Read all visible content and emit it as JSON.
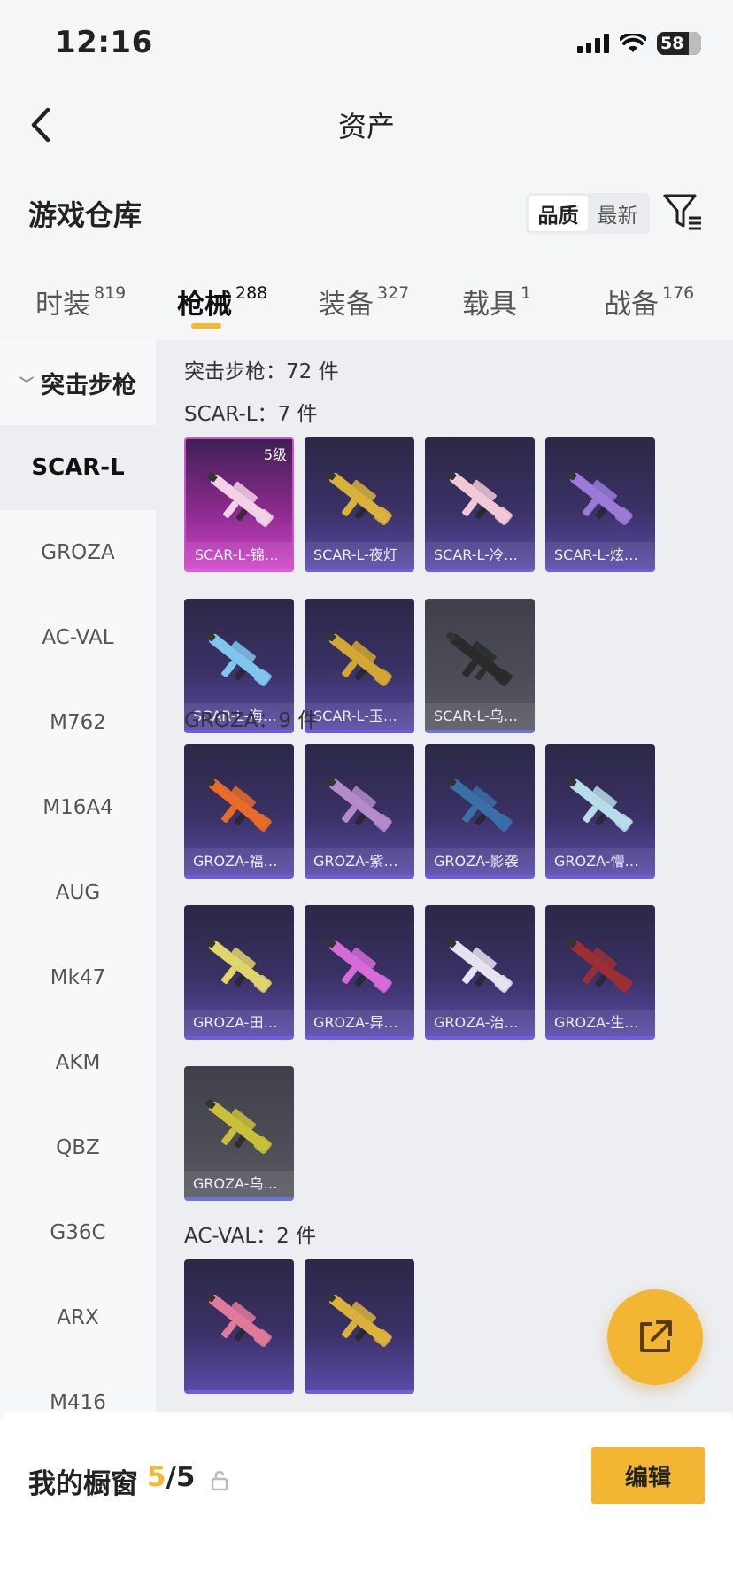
{
  "status": {
    "time": "12:16",
    "battery": "58"
  },
  "header": {
    "title": "资产"
  },
  "section": {
    "title": "游戏仓库",
    "sort_options": [
      "品质",
      "最新"
    ],
    "active_sort": "品质"
  },
  "tabs": [
    {
      "label": "时装",
      "count": "819",
      "active": false
    },
    {
      "label": "枪械",
      "count": "288",
      "active": true
    },
    {
      "label": "装备",
      "count": "327",
      "active": false
    },
    {
      "label": "载具",
      "count": "1",
      "active": false
    },
    {
      "label": "战备",
      "count": "176",
      "active": false
    }
  ],
  "sidebar": {
    "category": "突击步枪",
    "items": [
      "SCAR-L",
      "GROZA",
      "AC-VAL",
      "M762",
      "M16A4",
      "AUG",
      "Mk47",
      "AKM",
      "QBZ",
      "G36C",
      "ARX",
      "M416"
    ],
    "active": "SCAR-L"
  },
  "content": {
    "summary": "突击步枪：72 件",
    "groups": [
      {
        "title": "SCAR-L：7 件",
        "items": [
          {
            "name": "SCAR-L-锦…",
            "rarity": "pink",
            "level": "5级",
            "accent": "#f3d2e6"
          },
          {
            "name": "SCAR-L-夜灯",
            "rarity": "purple",
            "accent": "#d9b23b"
          },
          {
            "name": "SCAR-L-冷…",
            "rarity": "purple",
            "accent": "#f1c8d6"
          },
          {
            "name": "SCAR-L-炫…",
            "rarity": "purple",
            "accent": "#9b7ad8"
          },
          {
            "name": "SCAR-L-海…",
            "rarity": "purple",
            "accent": "#7fc6ef"
          },
          {
            "name": "SCAR-L-玉…",
            "rarity": "purple",
            "accent": "#d4a733"
          },
          {
            "name": "SCAR-L-乌…",
            "rarity": "grey",
            "accent": "#2a2a2a"
          }
        ]
      },
      {
        "title": "GROZA：9 件",
        "items": [
          {
            "name": "GROZA-福…",
            "rarity": "purple",
            "accent": "#e86b2a"
          },
          {
            "name": "GROZA-紫…",
            "rarity": "purple",
            "accent": "#b48ac8"
          },
          {
            "name": "GROZA-影袭",
            "rarity": "purple",
            "accent": "#3a6fa8"
          },
          {
            "name": "GROZA-懵…",
            "rarity": "purple",
            "accent": "#b8dde8"
          },
          {
            "name": "GROZA-田…",
            "rarity": "purple",
            "accent": "#e0d56a"
          },
          {
            "name": "GROZA-异…",
            "rarity": "purple",
            "accent": "#d56ad8"
          },
          {
            "name": "GROZA-治…",
            "rarity": "purple",
            "accent": "#e6e2ef"
          },
          {
            "name": "GROZA-生…",
            "rarity": "purple",
            "accent": "#9c2f33"
          },
          {
            "name": "GROZA-乌…",
            "rarity": "grey",
            "accent": "#c9c03a"
          }
        ]
      },
      {
        "title": "AC-VAL：2 件",
        "items": [
          {
            "name": "",
            "rarity": "purple",
            "accent": "#e07a9a"
          },
          {
            "name": "",
            "rarity": "purple",
            "accent": "#d9b23b"
          }
        ]
      }
    ]
  },
  "bottom": {
    "showcase_label": "我的橱窗",
    "showcase_current": "5",
    "showcase_total": "/5",
    "edit_label": "编辑"
  },
  "colors": {
    "accent": "#f3b632",
    "purple_border": "#6e5de0",
    "pink_border": "#e05ae0"
  }
}
